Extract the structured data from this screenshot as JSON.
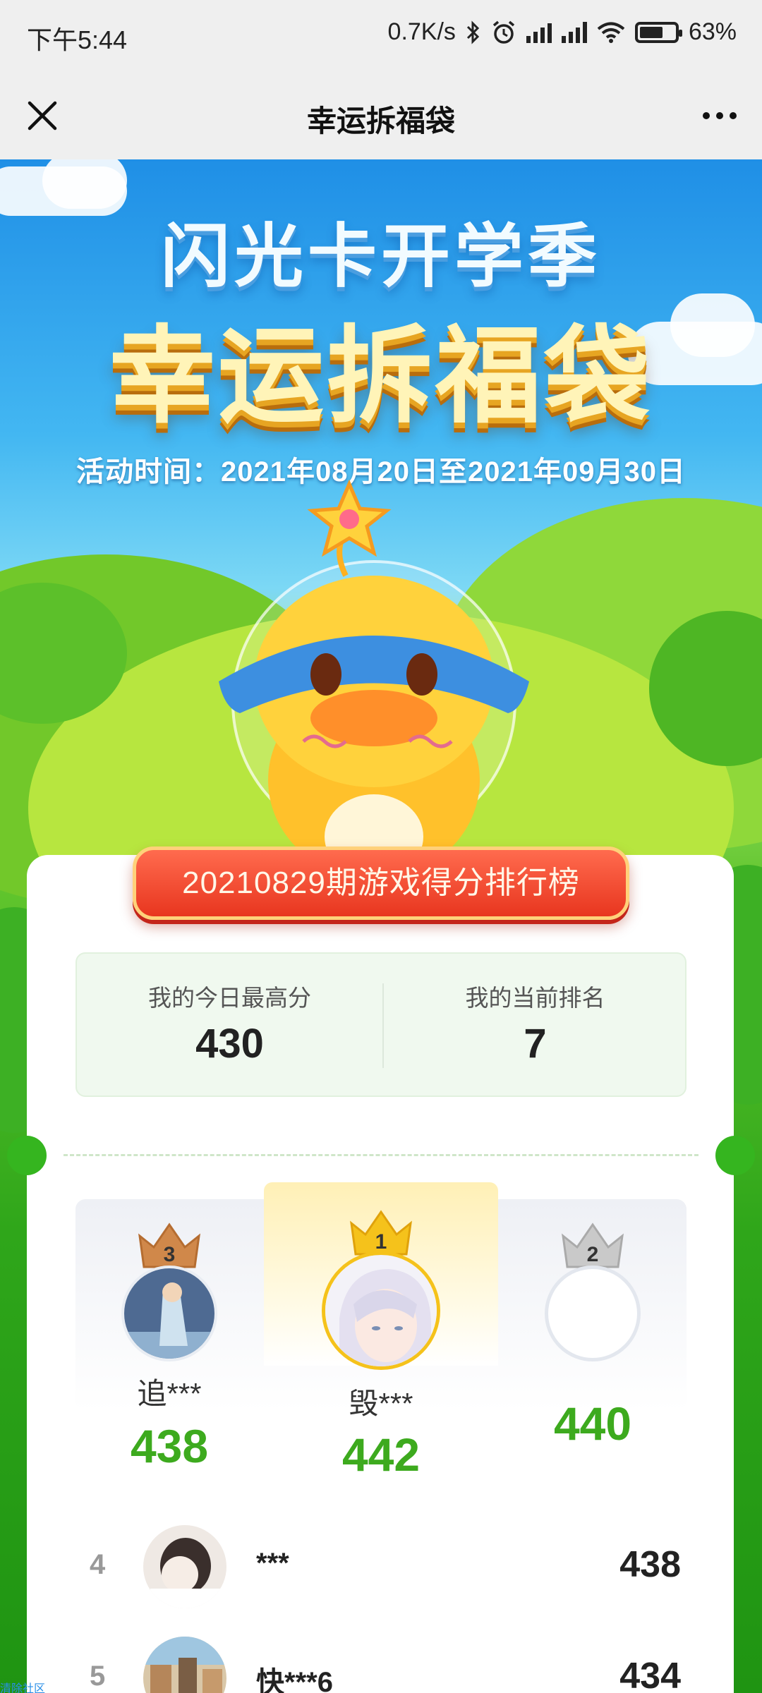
{
  "status_bar": {
    "time": "下午5:44",
    "net_speed": "0.7K/s",
    "battery": "63%",
    "icons": [
      "bluetooth-icon",
      "alarm-icon",
      "signal-icon",
      "hd-signal-icon",
      "wifi-icon",
      "battery-icon"
    ],
    "battery_level": 0.63
  },
  "title_bar": {
    "title": "幸运拆福袋",
    "close_icon": "close-icon",
    "more_icon": "more-icon"
  },
  "banner": {
    "subtitle": "闪光卡开学季",
    "title": "幸运拆福袋",
    "time": "活动时间：2021年08月20日至2021年09月30日"
  },
  "leaderboard": {
    "ribbon": "20210829期游戏得分排行榜",
    "my_best_label": "我的今日最高分",
    "my_best_value": "430",
    "my_rank_label": "我的当前排名",
    "my_rank_value": "7",
    "podium": [
      {
        "rank": "1",
        "name": "毁***",
        "score": "442"
      },
      {
        "rank": "2",
        "name": "",
        "score": "440"
      },
      {
        "rank": "3",
        "name": "追***",
        "score": "438"
      }
    ],
    "rows": [
      {
        "rank": "4",
        "name": "***",
        "score": "438"
      },
      {
        "rank": "5",
        "name": "快***6",
        "score": "434"
      }
    ]
  },
  "watermark": "清除社区",
  "colors": {
    "score_green": "#3daa1e",
    "ribbon_red": "#e8361f",
    "crown_gold": "#f5c21b",
    "crown_silver": "#c9c9c9",
    "crown_bronze": "#d0884a"
  }
}
